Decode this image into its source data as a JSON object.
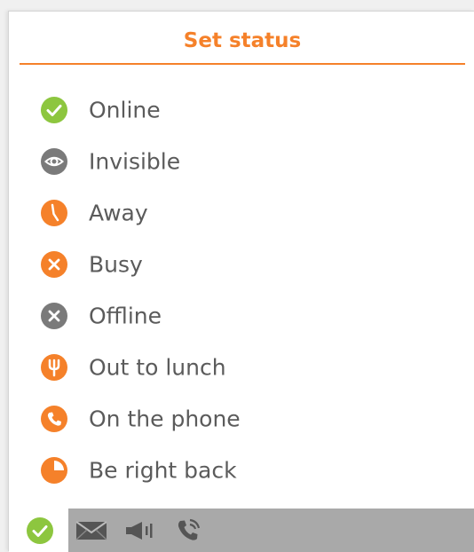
{
  "panel": {
    "title": "Set status",
    "accent_color": "#f5812a"
  },
  "statuses": [
    {
      "label": "Online",
      "icon": "check-icon",
      "color": "#8dc63f"
    },
    {
      "label": "Invisible",
      "icon": "eye-icon",
      "color": "#7a7a7a"
    },
    {
      "label": "Away",
      "icon": "clock-hand-icon",
      "color": "#f5812a"
    },
    {
      "label": "Busy",
      "icon": "x-icon",
      "color": "#f5812a"
    },
    {
      "label": "Offline",
      "icon": "x-icon",
      "color": "#7a7a7a"
    },
    {
      "label": "Out to lunch",
      "icon": "fork-icon",
      "color": "#f5812a"
    },
    {
      "label": "On the phone",
      "icon": "phone-icon",
      "color": "#f5812a"
    },
    {
      "label": "Be right back",
      "icon": "clock-icon",
      "color": "#f5812a"
    }
  ],
  "bottom_bar": {
    "current_status_icon": "check-icon",
    "icons": [
      "envelope-icon",
      "megaphone-icon",
      "phone-call-icon"
    ]
  }
}
